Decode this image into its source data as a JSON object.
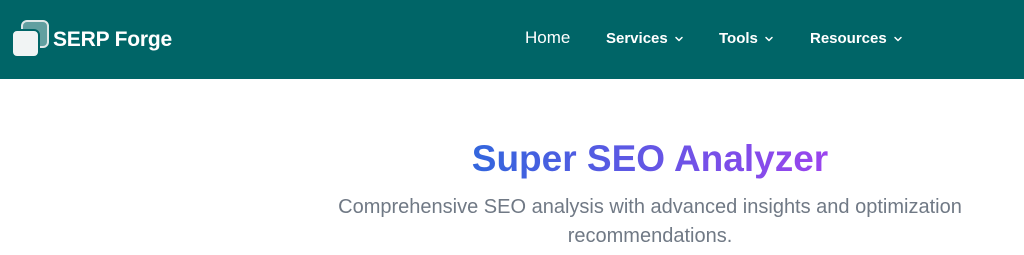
{
  "brand": {
    "name": "SERP Forge",
    "logo_icon": "stacked-squares-logo"
  },
  "nav": {
    "items": [
      {
        "label": "Home",
        "has_dropdown": false
      },
      {
        "label": "Services",
        "has_dropdown": true,
        "icon": "chevron-down-icon"
      },
      {
        "label": "Tools",
        "has_dropdown": true,
        "icon": "chevron-down-icon"
      },
      {
        "label": "Resources",
        "has_dropdown": true,
        "icon": "chevron-down-icon"
      }
    ]
  },
  "hero": {
    "title": "Super SEO Analyzer",
    "subtitle": "Comprehensive SEO analysis with advanced insights and optimization recommendations."
  },
  "colors": {
    "header_background": "#006567",
    "title_gradient_start": "#3366dd",
    "title_gradient_end": "#9b44ee",
    "subtitle_text": "#707985"
  }
}
